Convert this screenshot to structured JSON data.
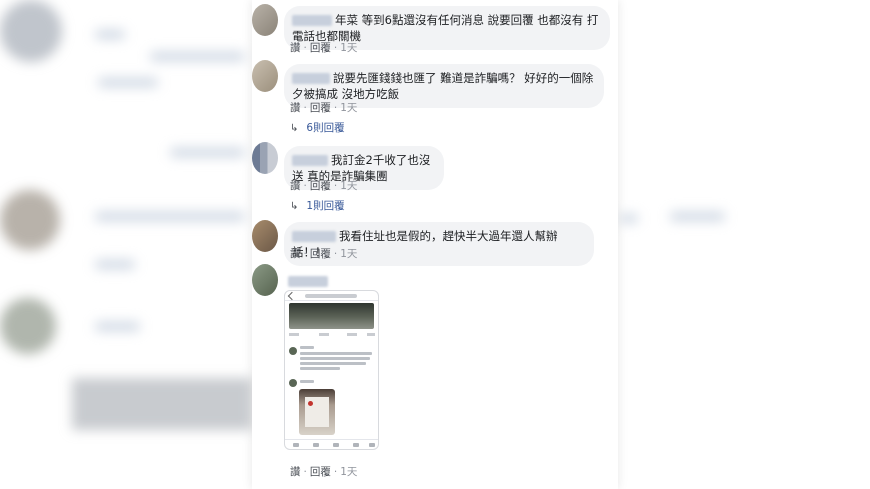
{
  "comments": [
    {
      "text": "年菜 等到6點還沒有任何消息 說要回覆 也都沒有 打電話也都關機",
      "actions": {
        "like": "讚",
        "reply": "回覆",
        "time": "1天"
      }
    },
    {
      "text": "說要先匯錢錢也匯了 難道是詐騙嗎？ 好好的一個除夕被搞成 沒地方吃飯",
      "actions": {
        "like": "讚",
        "reply": "回覆",
        "time": "1天"
      },
      "replies_label": "6則回覆"
    },
    {
      "text": "我訂金2千收了也沒送 真的是詐騙集團",
      "actions": {
        "like": "讚",
        "reply": "回覆",
        "time": "1天"
      },
      "replies_label": "1則回覆"
    },
    {
      "text": "我看住址也是假的，趕快半大過年還人幫辦話！！",
      "actions": {
        "like": "讚",
        "reply": "回覆",
        "time": "1天"
      }
    },
    {
      "actions": {
        "like": "讚",
        "reply": "回覆",
        "time": "1天"
      }
    }
  ],
  "icons": {
    "reply_arrow": "reply-arrow-icon"
  }
}
